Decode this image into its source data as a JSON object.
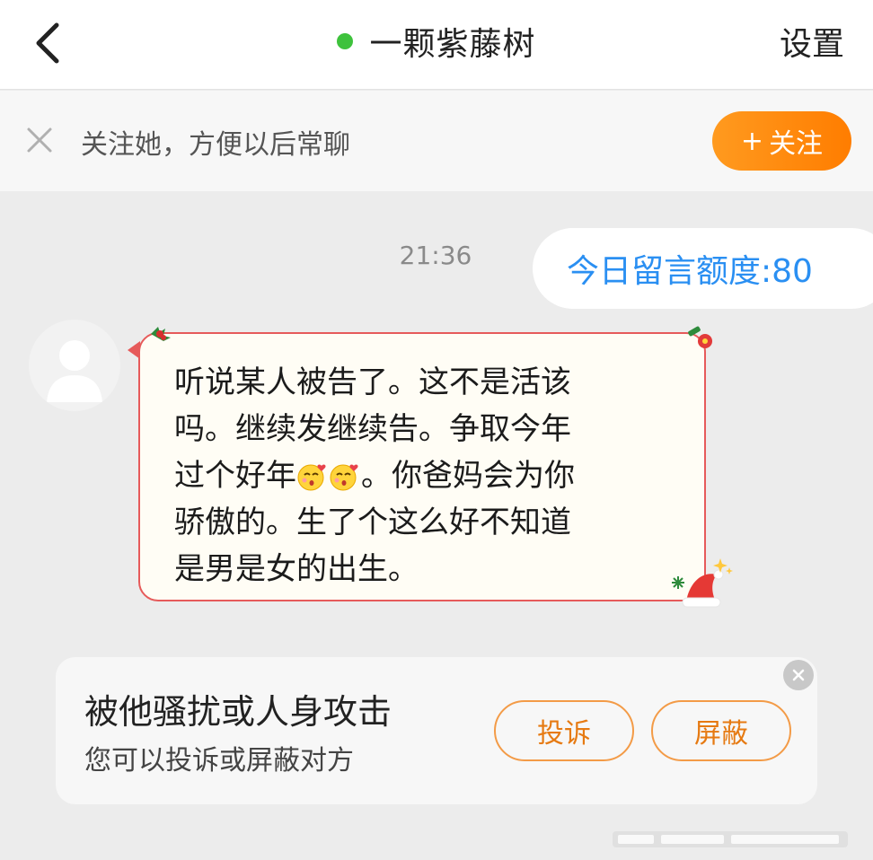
{
  "header": {
    "back_icon": "chevron-left-icon",
    "online_color": "#3ec23c",
    "title": "一颗紫藤树",
    "settings_label": "设置"
  },
  "follow_banner": {
    "close_icon": "close-icon",
    "text": "关注她，方便以后常聊",
    "button_plus": "+",
    "button_label": "关注",
    "button_color": "#ff8a10"
  },
  "chat": {
    "timestamp": "21:36",
    "quota_text": "今日留言额度:80",
    "quota_color": "#2a8ff2",
    "message": {
      "line1": "听说某人被告了。这不是活该",
      "line2": "吗。继续发继续告。争取今年",
      "line3_a": "过个好年",
      "line3_emoji": "kissing-face-emoji",
      "line3_b": "。你爸妈会为你",
      "line4": "骄傲的。生了个这么好不知道",
      "line5": "是男是女的出生。",
      "border_color": "#e65a5a"
    }
  },
  "report_card": {
    "title": "被他骚扰或人身攻击",
    "subtitle": "您可以投诉或屏蔽对方",
    "complain_label": "投诉",
    "block_label": "屏蔽",
    "accent_color": "#e67a12",
    "close_icon": "close-icon"
  }
}
